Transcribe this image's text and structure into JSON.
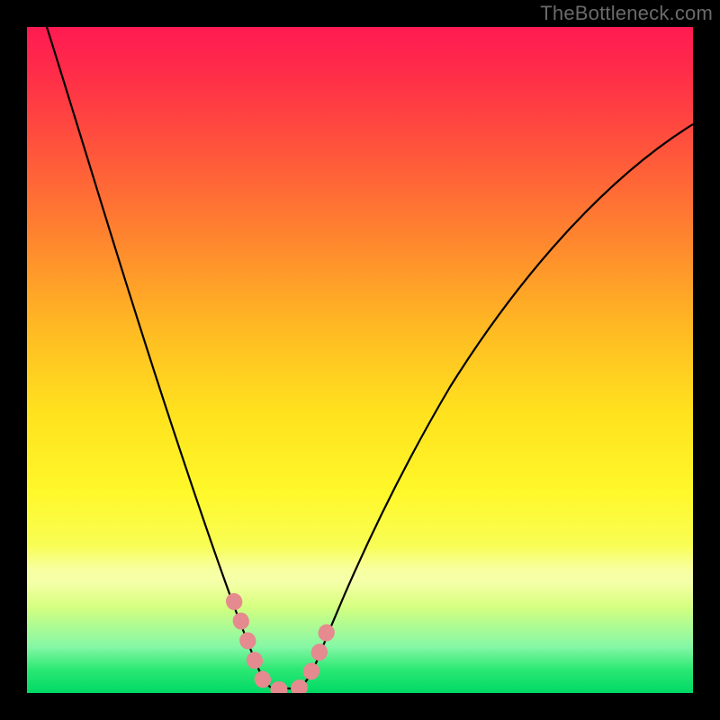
{
  "watermark": "TheBottleneck.com",
  "chart_data": {
    "type": "line",
    "title": "",
    "xlabel": "",
    "ylabel": "",
    "xlim": [
      0,
      1
    ],
    "ylim": [
      0,
      1
    ],
    "grid": false,
    "background_gradient": {
      "direction": "vertical",
      "stops": [
        {
          "pos": 0.0,
          "color": "#ff1a52"
        },
        {
          "pos": 0.2,
          "color": "#ff5a3a"
        },
        {
          "pos": 0.45,
          "color": "#ffb923"
        },
        {
          "pos": 0.7,
          "color": "#fff82a"
        },
        {
          "pos": 0.87,
          "color": "#d5ff80"
        },
        {
          "pos": 1.0,
          "color": "#00d966"
        }
      ]
    },
    "series": [
      {
        "name": "bottleneck-curve",
        "stroke": "#000000",
        "x": [
          0.03,
          0.08,
          0.12,
          0.16,
          0.2,
          0.24,
          0.27,
          0.3,
          0.325,
          0.345,
          0.365,
          0.385,
          0.41,
          0.44,
          0.48,
          0.52,
          0.56,
          0.62,
          0.7,
          0.8,
          0.9,
          1.0
        ],
        "y": [
          1.0,
          0.86,
          0.74,
          0.62,
          0.5,
          0.38,
          0.27,
          0.16,
          0.08,
          0.03,
          0.015,
          0.03,
          0.09,
          0.18,
          0.3,
          0.41,
          0.5,
          0.6,
          0.7,
          0.78,
          0.83,
          0.86
        ]
      },
      {
        "name": "highlight-band",
        "stroke": "#e58a8f",
        "stroke_width": 11,
        "x": [
          0.3,
          0.315,
          0.33,
          0.345,
          0.36,
          0.375,
          0.39,
          0.405,
          0.42
        ],
        "y": [
          0.15,
          0.095,
          0.05,
          0.02,
          0.015,
          0.02,
          0.04,
          0.08,
          0.14
        ]
      }
    ],
    "annotations": []
  }
}
